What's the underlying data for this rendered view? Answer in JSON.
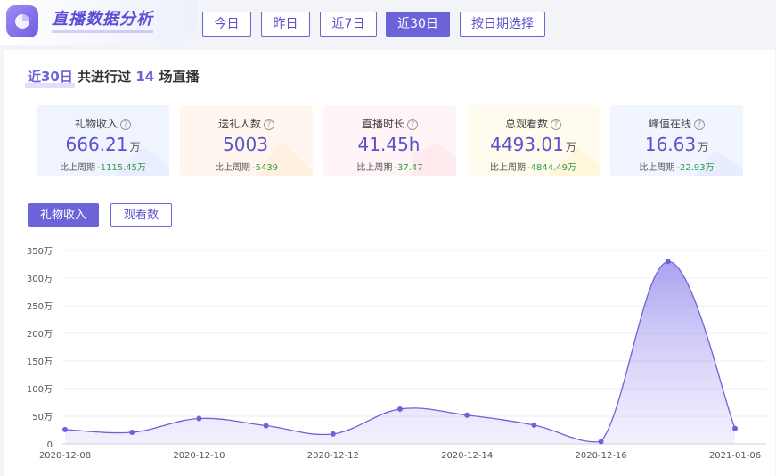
{
  "header": {
    "title": "直播数据分析",
    "ranges": [
      "今日",
      "昨日",
      "近7日",
      "近30日",
      "按日期选择"
    ],
    "active_range": "近30日"
  },
  "summary": {
    "period": "近30日",
    "text_before": "共进行过",
    "count": "14",
    "text_after": "场直播"
  },
  "stats": [
    {
      "label": "礼物收入",
      "value": "666.21",
      "unit": "万",
      "compare_label": "比上周期",
      "delta": "-1115.45万",
      "bg": "#f0f4ff"
    },
    {
      "label": "送礼人数",
      "value": "5003",
      "unit": "",
      "compare_label": "比上周期",
      "delta": "-5439",
      "bg": "#fff7ef"
    },
    {
      "label": "直播时长",
      "value": "41.45h",
      "unit": "",
      "compare_label": "比上周期",
      "delta": "-37.47",
      "bg": "#fff5f6"
    },
    {
      "label": "总观看数",
      "value": "4493.01",
      "unit": "万",
      "compare_label": "比上周期",
      "delta": "-4844.49万",
      "bg": "#fffbee"
    },
    {
      "label": "峰值在线",
      "value": "16.63",
      "unit": "万",
      "compare_label": "比上周期",
      "delta": "-22.93万",
      "bg": "#f0f5ff"
    }
  ],
  "tabs": [
    "礼物收入",
    "观看数"
  ],
  "active_tab": "礼物收入",
  "colors": {
    "accent": "#6c63d8",
    "positive": "#2f9e44"
  },
  "chart_data": {
    "type": "area",
    "y_unit": "万",
    "ylim": [
      0,
      350
    ],
    "yticks": [
      "0",
      "50万",
      "100万",
      "150万",
      "200万",
      "250万",
      "300万",
      "350万"
    ],
    "x_tick_labels": [
      "2020-12-08",
      "2020-12-10",
      "2020-12-12",
      "2020-12-14",
      "2020-12-16",
      "2021-01-06"
    ],
    "points": [
      {
        "i": 0,
        "y": 26
      },
      {
        "i": 1,
        "y": 21
      },
      {
        "i": 2,
        "y": 46
      },
      {
        "i": 3,
        "y": 33
      },
      {
        "i": 4,
        "y": 18
      },
      {
        "i": 5,
        "y": 63
      },
      {
        "i": 6,
        "y": 52
      },
      {
        "i": 7,
        "y": 34
      },
      {
        "i": 8,
        "y": 4
      },
      {
        "i": 9,
        "y": 330
      },
      {
        "i": 10,
        "y": 28
      }
    ],
    "grid": true,
    "smooth": true
  }
}
